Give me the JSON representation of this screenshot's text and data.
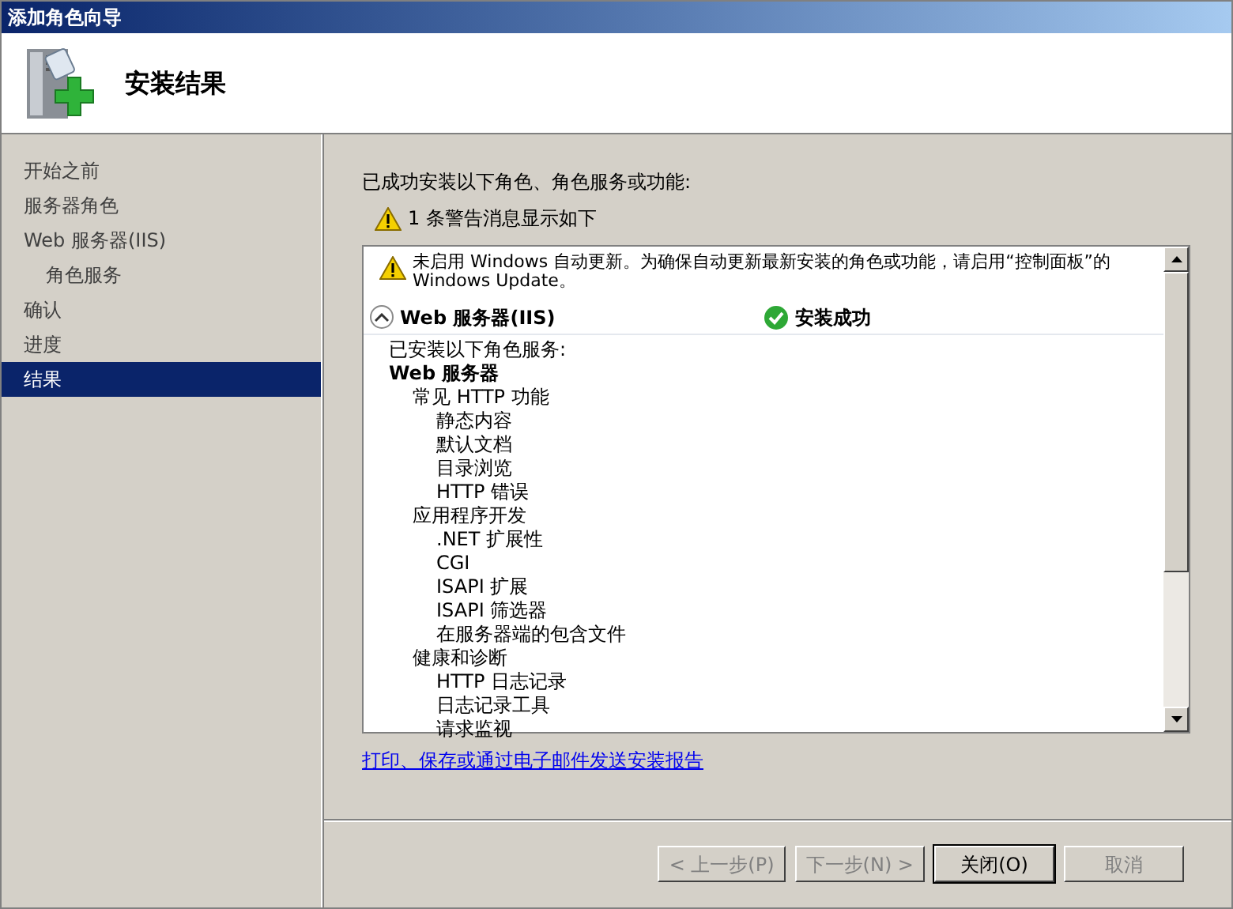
{
  "window": {
    "title": "添加角色向导"
  },
  "header": {
    "title": "安装结果"
  },
  "sidebar": {
    "items": [
      {
        "label": "开始之前",
        "selected": false
      },
      {
        "label": "服务器角色",
        "selected": false
      },
      {
        "label": "Web 服务器(IIS)",
        "selected": false,
        "children": [
          {
            "label": "角色服务",
            "selected": false
          }
        ]
      },
      {
        "label": "确认",
        "selected": false
      },
      {
        "label": "进度",
        "selected": false
      },
      {
        "label": "结果",
        "selected": true
      }
    ]
  },
  "summary": "已成功安装以下角色、角色服务或功能:",
  "warning_count": "1 条警告消息显示如下",
  "results": {
    "warning": "未启用 Windows 自动更新。为确保自动更新最新安装的角色或功能，请启用“控制面板”的 Windows Update。",
    "role": {
      "name": "Web 服务器(IIS)",
      "expanded": true,
      "status": "安装成功"
    },
    "intro": "已安装以下角色服务:",
    "tree": [
      {
        "label": "Web 服务器",
        "children": [
          {
            "label": "常见 HTTP 功能",
            "children": [
              {
                "label": "静态内容"
              },
              {
                "label": "默认文档"
              },
              {
                "label": "目录浏览"
              },
              {
                "label": "HTTP 错误"
              }
            ]
          },
          {
            "label": "应用程序开发",
            "children": [
              {
                "label": ".NET 扩展性"
              },
              {
                "label": "CGI"
              },
              {
                "label": "ISAPI 扩展"
              },
              {
                "label": "ISAPI 筛选器"
              },
              {
                "label": "在服务器端的包含文件"
              }
            ]
          },
          {
            "label": "健康和诊断",
            "children": [
              {
                "label": "HTTP 日志记录"
              },
              {
                "label": "日志记录工具"
              },
              {
                "label": "请求监视"
              }
            ]
          }
        ]
      }
    ]
  },
  "report_link": "打印、保存或通过电子邮件发送安装报告",
  "buttons": [
    {
      "label": "< 上一步(P)",
      "disabled": true
    },
    {
      "label": "下一步(N) >",
      "disabled": true
    },
    {
      "label": "关闭(O)",
      "disabled": false
    },
    {
      "label": "取消",
      "disabled": true
    }
  ]
}
